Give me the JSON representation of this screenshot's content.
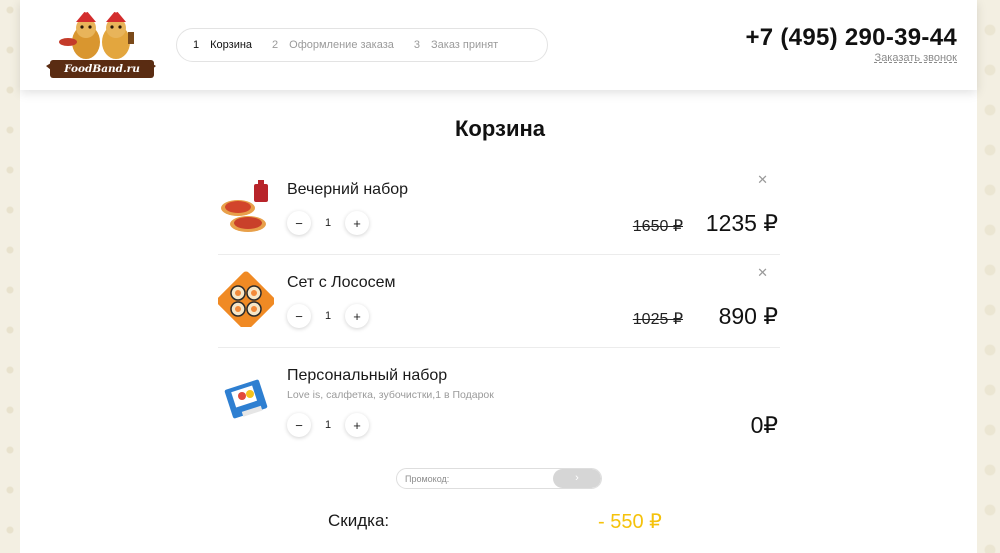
{
  "brand": {
    "logo_text": "FoodBand.ru"
  },
  "steps": [
    {
      "num": "1",
      "label": "Корзина",
      "active": true
    },
    {
      "num": "2",
      "label": "Оформление заказа",
      "active": false
    },
    {
      "num": "3",
      "label": "Заказ принят",
      "active": false
    }
  ],
  "contact": {
    "phone": "+7 (495) 290-39-44",
    "callback": "Заказать звонок"
  },
  "page": {
    "title": "Корзина"
  },
  "cart": {
    "items": [
      {
        "name": "Вечерний набор",
        "qty": "1",
        "old_price": "1650 ₽",
        "price": "1235 ₽",
        "removable": true
      },
      {
        "name": "Сет с Лососем",
        "qty": "1",
        "old_price": "1025 ₽",
        "price": "890 ₽",
        "removable": true
      },
      {
        "name": "Персональный набор",
        "subtitle": "Love is, салфетка, зубочистки,1 в Подарок",
        "qty": "1",
        "price": "0₽",
        "removable": false
      }
    ],
    "controls": {
      "minus": "−",
      "plus": "+",
      "remove": "✕"
    }
  },
  "promo": {
    "placeholder": "Промокод:",
    "submit": "›"
  },
  "discount": {
    "label": "Скидка:",
    "value": "- 550 ₽"
  },
  "colors": {
    "accent": "#f5c20b",
    "logo_bg": "#5a2c12"
  }
}
